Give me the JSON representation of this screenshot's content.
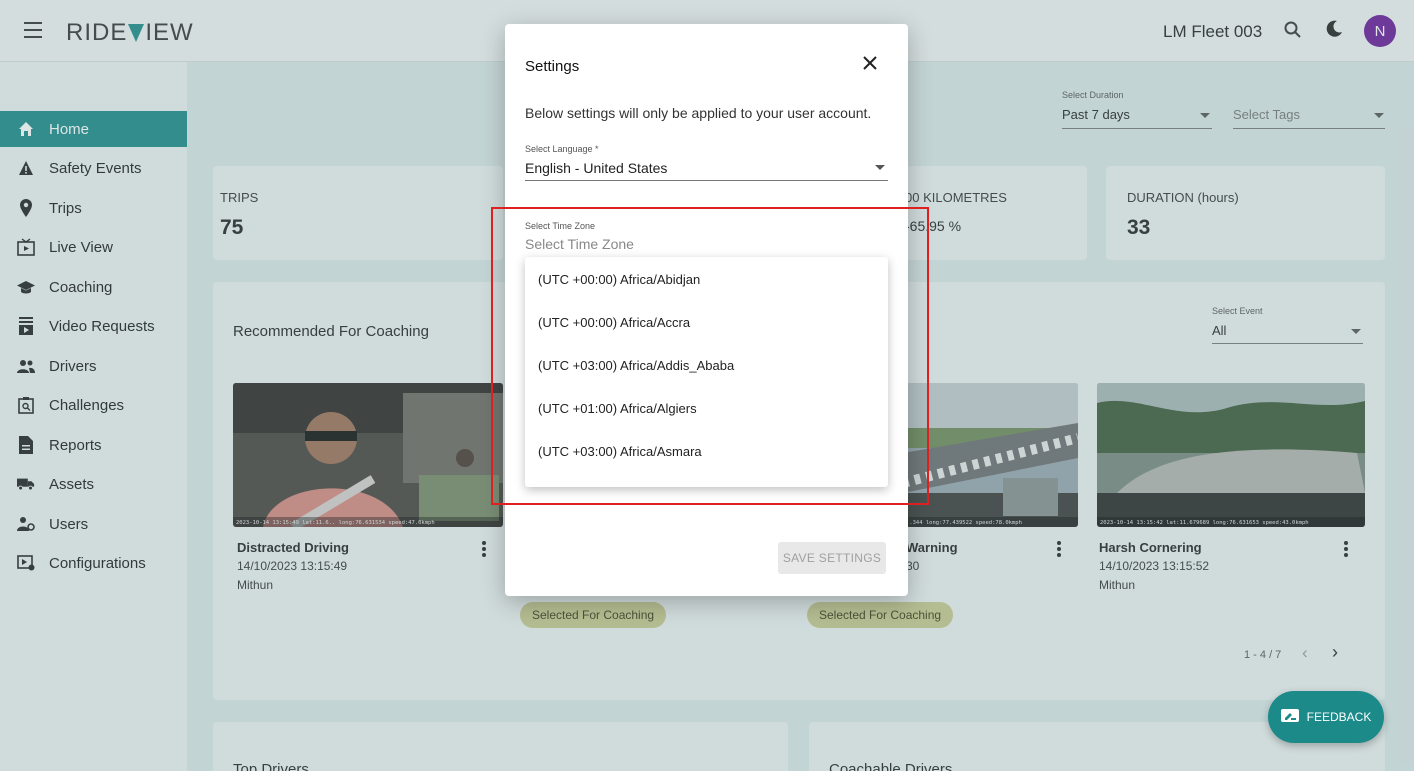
{
  "app": {
    "logo": "RIDE",
    "logo_suffix": "IEW",
    "fleet_name": "LM Fleet 003",
    "avatar_letter": "N"
  },
  "sidebar": {
    "items": [
      {
        "label": "Home",
        "icon": "home-icon",
        "active": true
      },
      {
        "label": "Safety Events",
        "icon": "warning-icon"
      },
      {
        "label": "Trips",
        "icon": "location-pin-icon"
      },
      {
        "label": "Live View",
        "icon": "live-view-icon"
      },
      {
        "label": "Coaching",
        "icon": "graduation-cap-icon"
      },
      {
        "label": "Video Requests",
        "icon": "video-request-icon"
      },
      {
        "label": "Drivers",
        "icon": "people-icon"
      },
      {
        "label": "Challenges",
        "icon": "challenge-icon"
      },
      {
        "label": "Reports",
        "icon": "report-icon"
      },
      {
        "label": "Assets",
        "icon": "truck-icon"
      },
      {
        "label": "Users",
        "icon": "users-gear-icon"
      },
      {
        "label": "Configurations",
        "icon": "config-icon"
      }
    ]
  },
  "filters": {
    "duration_label": "Select Duration",
    "duration_value": "Past 7 days",
    "tags_placeholder": "Select Tags"
  },
  "stats": {
    "trips_label": "TRIPS",
    "trips_value": "75",
    "per_km_label": "00 KILOMETRES",
    "per_km_value": "-65.95 %",
    "duration_label": "DURATION (hours)",
    "duration_value": "33"
  },
  "coaching": {
    "title": "Recommended For Coaching",
    "event_label": "Select Event",
    "event_value": "All",
    "events": [
      {
        "title": "Distracted Driving",
        "date": "14/10/2023 13:15:49",
        "driver": "Mithun",
        "overlay": "2023-10-14 13:15:49 lat:11.6.. long:76.631534 speed:47.0kmph"
      },
      {
        "title": "Warning",
        "date": "30",
        "chip": "Selected For Coaching",
        "overlay": "..344 long:77.439522 speed:78.0kmph"
      },
      {
        "title": "Harsh Cornering",
        "date": "14/10/2023 13:15:52",
        "driver": "Mithun",
        "overlay": "2023-10-14 13:15:42 lat:11.679689 long:76.631653 speed:43.0kmph"
      }
    ],
    "chip_left": "Selected For Coaching",
    "pager": "1 - 4 / 7"
  },
  "bottom": {
    "left_title": "Top Drivers",
    "right_title": "Coachable Drivers"
  },
  "dialog": {
    "title": "Settings",
    "description": "Below settings will only be applied to your user account.",
    "language_label": "Select Language *",
    "language_value": "English - United States",
    "timezone_label": "Select Time Zone",
    "timezone_placeholder": "Select Time Zone",
    "save_label": "SAVE SETTINGS",
    "timezones": [
      "(UTC +00:00) Africa/Abidjan",
      "(UTC +00:00) Africa/Accra",
      "(UTC +03:00) Africa/Addis_Ababa",
      "(UTC +01:00) Africa/Algiers",
      "(UTC +03:00) Africa/Asmara"
    ]
  },
  "feedback_label": "FEEDBACK",
  "colors": {
    "accent": "#1d8a8a",
    "avatar": "#6a1b9a",
    "highlight": "#e02020",
    "chip": "#c9c98f"
  }
}
